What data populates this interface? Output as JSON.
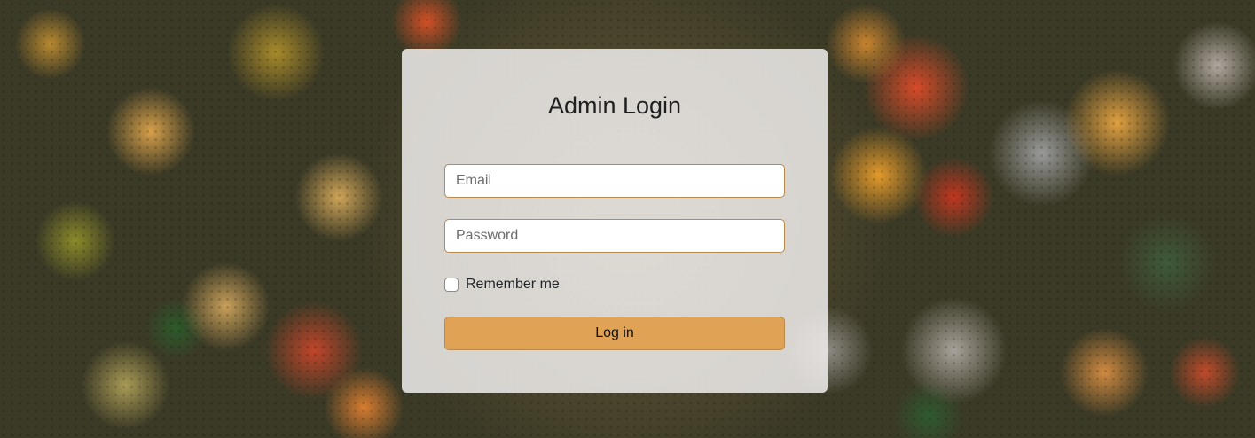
{
  "background": {
    "description_icon": "forest-aerial-background"
  },
  "login": {
    "title": "Admin Login",
    "email_placeholder": "Email",
    "email_value": "",
    "password_placeholder": "Password",
    "password_value": "",
    "remember_label": "Remember me",
    "remember_checked": false,
    "submit_label": "Log in"
  },
  "colors": {
    "accent": "#e0a356",
    "field_border": "#b98a4f",
    "card_background": "#f0eeec"
  }
}
